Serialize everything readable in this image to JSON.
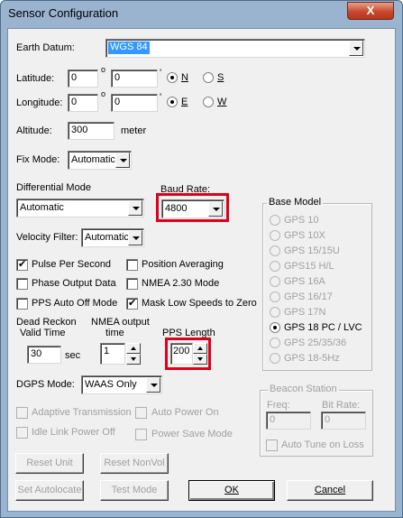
{
  "window": {
    "title": "Sensor Configuration",
    "close_glyph": "X"
  },
  "earth_datum": {
    "label": "Earth Datum:",
    "value": "WGS 84"
  },
  "latitude": {
    "label": "Latitude:",
    "deg": "0",
    "min": "0",
    "deg_symbol": "o",
    "min_symbol": "'",
    "opt1": "N",
    "opt2": "S",
    "selected": "N"
  },
  "longitude": {
    "label": "Longitude:",
    "deg": "0",
    "min": "0",
    "deg_symbol": "o",
    "min_symbol": "'",
    "opt1": "E",
    "opt2": "W",
    "selected": "E"
  },
  "altitude": {
    "label": "Altitude:",
    "value": "300",
    "unit": "meter"
  },
  "fix_mode": {
    "label": "Fix Mode:",
    "value": "Automatic"
  },
  "differential_mode": {
    "label": "Differential Mode",
    "value": "Automatic"
  },
  "baud_rate": {
    "label": "Baud Rate:",
    "value": "4800"
  },
  "velocity_filter": {
    "label": "Velocity Filter:",
    "value": "Automatic"
  },
  "checkboxes": {
    "pulse_per_second": {
      "label": "Pulse Per Second",
      "checked": true
    },
    "position_averaging": {
      "label": "Position Averaging",
      "checked": false
    },
    "phase_output_data": {
      "label": "Phase Output Data",
      "checked": false
    },
    "nmea_230_mode": {
      "label": "NMEA 2.30 Mode",
      "checked": false
    },
    "pps_auto_off_mode": {
      "label": "PPS Auto Off Mode",
      "checked": false
    },
    "mask_low_speeds": {
      "label": "Mask Low Speeds to Zero",
      "checked": true
    }
  },
  "dead_reckon": {
    "label_line1": "Dead Reckon",
    "label_line2": "Valid Time",
    "value": "30",
    "unit": "sec"
  },
  "nmea_output": {
    "label_line1": "NMEA output",
    "label_line2": "time",
    "value": "1"
  },
  "pps_length": {
    "label": "PPS Length",
    "value": "200"
  },
  "base_model": {
    "title": "Base Model",
    "selected": "GPS 18 PC / LVC",
    "items": [
      "GPS 10",
      "GPS 10X",
      "GPS 15/15U",
      "GPS15 H/L",
      "GPS 16A",
      "GPS 16/17",
      "GPS 17N",
      "GPS 18 PC / LVC",
      "GPS 25/35/36",
      "GPS 18-5Hz"
    ]
  },
  "dgps_mode": {
    "label": "DGPS Mode:",
    "value": "WAAS Only"
  },
  "disabled_options": {
    "adaptive_transmission": "Adaptive Transmission",
    "auto_power_on": "Auto Power On",
    "idle_link_power_off": "Idle Link Power Off",
    "power_save_mode": "Power Save Mode"
  },
  "beacon_station": {
    "title": "Beacon Station",
    "freq_label": "Freq:",
    "freq_value": "0",
    "bitrate_label": "Bit Rate:",
    "bitrate_value": "0",
    "auto_tune_label": "Auto Tune on Loss"
  },
  "buttons": {
    "reset_unit": "Reset Unit",
    "reset_nonvol": "Reset NonVol",
    "set_autolocate": "Set Autolocate",
    "test_mode": "Test Mode",
    "ok": "OK",
    "cancel": "Cancel"
  },
  "colors": {
    "highlight_box": "#e0001b",
    "selection": "#3399ff",
    "close_button": "#c74a2e"
  }
}
